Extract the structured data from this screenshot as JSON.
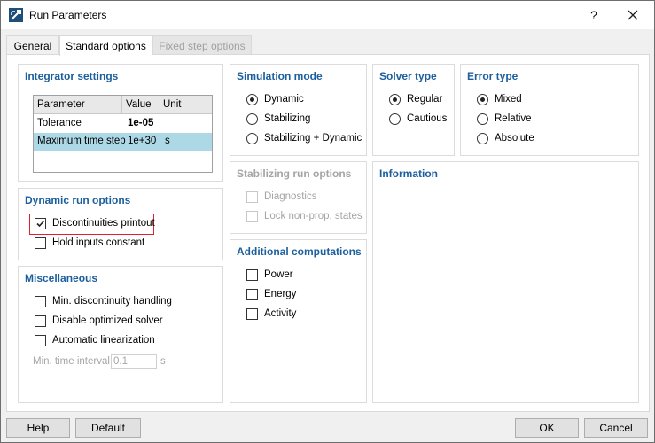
{
  "window": {
    "title": "Run Parameters",
    "help_label": "?"
  },
  "tabs": [
    {
      "label": "General"
    },
    {
      "label": "Standard options"
    },
    {
      "label": "Fixed step options"
    }
  ],
  "integrator": {
    "title": "Integrator settings",
    "columns": [
      "Parameter",
      "Value",
      "Unit"
    ],
    "rows": [
      {
        "parameter": "Tolerance",
        "value": "1e-05",
        "unit": ""
      },
      {
        "parameter": "Maximum time step",
        "value": "1e+30",
        "unit": "s"
      }
    ]
  },
  "dynamic_run": {
    "title": "Dynamic run options",
    "options": [
      {
        "label": "Discontinuities printout",
        "checked": true
      },
      {
        "label": "Hold inputs constant",
        "checked": false
      }
    ]
  },
  "misc": {
    "title": "Miscellaneous",
    "options": [
      {
        "label": "Min. discontinuity handling",
        "checked": false
      },
      {
        "label": "Disable optimized solver",
        "checked": false
      },
      {
        "label": "Automatic linearization",
        "checked": false
      }
    ],
    "min_time_label": "Min. time interval",
    "min_time_value": "0.1",
    "min_time_unit": "s"
  },
  "simulation_mode": {
    "title": "Simulation mode",
    "options": [
      {
        "label": "Dynamic",
        "selected": true
      },
      {
        "label": "Stabilizing",
        "selected": false
      },
      {
        "label": "Stabilizing + Dynamic",
        "selected": false
      }
    ]
  },
  "stabilizing": {
    "title": "Stabilizing run options",
    "options": [
      {
        "label": "Diagnostics"
      },
      {
        "label": "Lock non-prop. states"
      }
    ]
  },
  "additional": {
    "title": "Additional computations",
    "options": [
      {
        "label": "Power"
      },
      {
        "label": "Energy"
      },
      {
        "label": "Activity"
      }
    ]
  },
  "solver_type": {
    "title": "Solver type",
    "options": [
      {
        "label": "Regular",
        "selected": true
      },
      {
        "label": "Cautious",
        "selected": false
      }
    ]
  },
  "error_type": {
    "title": "Error type",
    "options": [
      {
        "label": "Mixed",
        "selected": true
      },
      {
        "label": "Relative",
        "selected": false
      },
      {
        "label": "Absolute",
        "selected": false
      }
    ]
  },
  "information": {
    "title": "Information"
  },
  "buttons": {
    "help": "Help",
    "default": "Default",
    "ok": "OK",
    "cancel": "Cancel"
  },
  "colors": {
    "group_title": "#1d5f9c",
    "selected_row": "#add8e6",
    "highlight": "#e0202a"
  }
}
